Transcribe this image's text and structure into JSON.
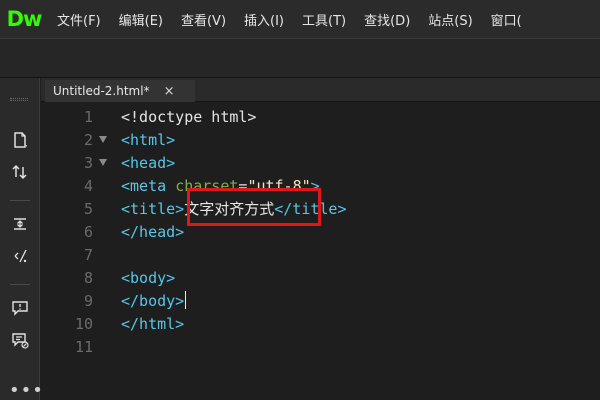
{
  "app": {
    "logo": "Dw"
  },
  "menu": {
    "items": [
      "文件(F)",
      "编辑(E)",
      "查看(V)",
      "插入(I)",
      "工具(T)",
      "查找(D)",
      "站点(S)",
      "窗口("
    ]
  },
  "tab": {
    "label": "Untitled-2.html*",
    "close": "×"
  },
  "sidebar": {
    "icons": [
      "file-icon",
      "sort-icon",
      "expand-collapse-icon",
      "format-icon",
      "comment-icon",
      "code-hint-icon"
    ],
    "more": "•••"
  },
  "editor": {
    "line_numbers": [
      "1",
      "2",
      "3",
      "4",
      "5",
      "6",
      "7",
      "8",
      "9",
      "10",
      "11"
    ],
    "lines": {
      "l1": "<!doctype html>",
      "l2": "<html>",
      "l3": "<head>",
      "l4_tag": "<meta ",
      "l4_attr": "charset",
      "l4_eq": "=",
      "l4_val": "\"utf-8\"",
      "l4_close": ">",
      "l5_open": "<title>",
      "l5_text": "文字对齐方式",
      "l5_close": "</title>",
      "l6": "</head>",
      "l8": "<body>",
      "l9": "</body>",
      "l10": "</html>"
    }
  },
  "colors": {
    "logo": "#35fa00",
    "tag": "#55c7e9",
    "attr": "#7cb342",
    "string": "#efe9c0",
    "highlight": "#e0161b"
  }
}
